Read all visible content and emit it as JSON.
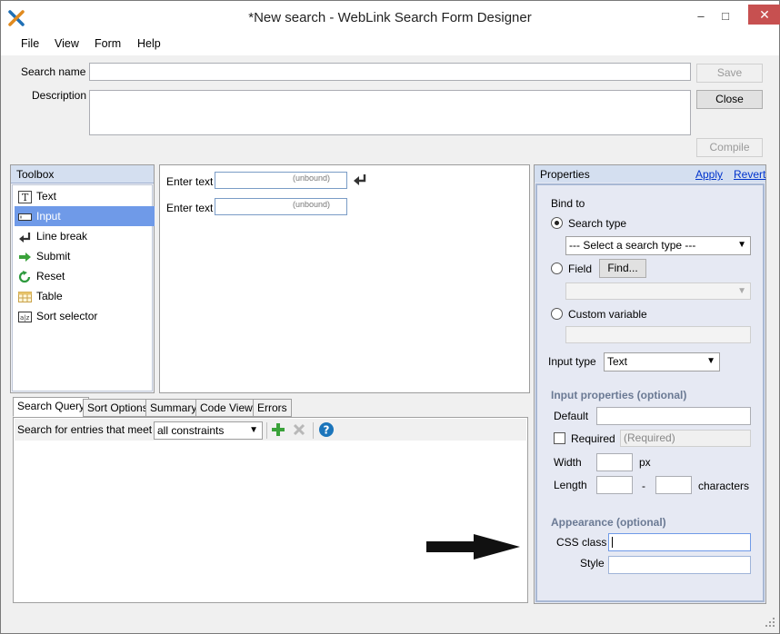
{
  "window": {
    "title": "*New search - WebLink Search Form Designer",
    "minimize": "‒",
    "maximize": "□",
    "close": "✕"
  },
  "menu": [
    "File",
    "View",
    "Form",
    "Help"
  ],
  "header": {
    "search_name_label": "Search name",
    "search_name_value": "",
    "description_label": "Description",
    "description_value": "",
    "save_label": "Save",
    "close_label": "Close",
    "compile_label": "Compile"
  },
  "toolbox": {
    "title": "Toolbox",
    "items": [
      {
        "label": "Text",
        "icon": "text-icon"
      },
      {
        "label": "Input",
        "icon": "input-icon"
      },
      {
        "label": "Line break",
        "icon": "line-break-icon"
      },
      {
        "label": "Submit",
        "icon": "submit-arrow-icon"
      },
      {
        "label": "Reset",
        "icon": "reset-icon"
      },
      {
        "label": "Table",
        "icon": "table-icon"
      },
      {
        "label": "Sort selector",
        "icon": "sort-selector-icon"
      }
    ],
    "selected_index": 1
  },
  "canvas": {
    "rows": [
      {
        "label": "Enter text",
        "placeholder": "(unbound)"
      },
      {
        "label": "Enter text",
        "placeholder": "(unbound)"
      }
    ]
  },
  "tabs": [
    "Search Query",
    "Sort Options",
    "Summary",
    "Code View",
    "Errors"
  ],
  "active_tab": 0,
  "query": {
    "label": "Search for entries that meet",
    "constraint_value": "all constraints"
  },
  "properties": {
    "title": "Properties",
    "apply": "Apply",
    "revert": "Revert",
    "bind_to": "Bind to",
    "search_type_label": "Search type",
    "search_type_select": "--- Select a search type ---",
    "field_label": "Field",
    "find_label": "Find...",
    "custom_variable_label": "Custom variable",
    "input_type_label": "Input type",
    "input_type_value": "Text",
    "input_props_title": "Input properties (optional)",
    "default_label": "Default",
    "required_label": "Required",
    "required_placeholder": "(Required)",
    "width_label": "Width",
    "width_unit": "px",
    "length_label": "Length",
    "length_sep": "-",
    "length_unit": "characters",
    "appearance_title": "Appearance (optional)",
    "css_class_label": "CSS class",
    "style_label": "Style"
  }
}
